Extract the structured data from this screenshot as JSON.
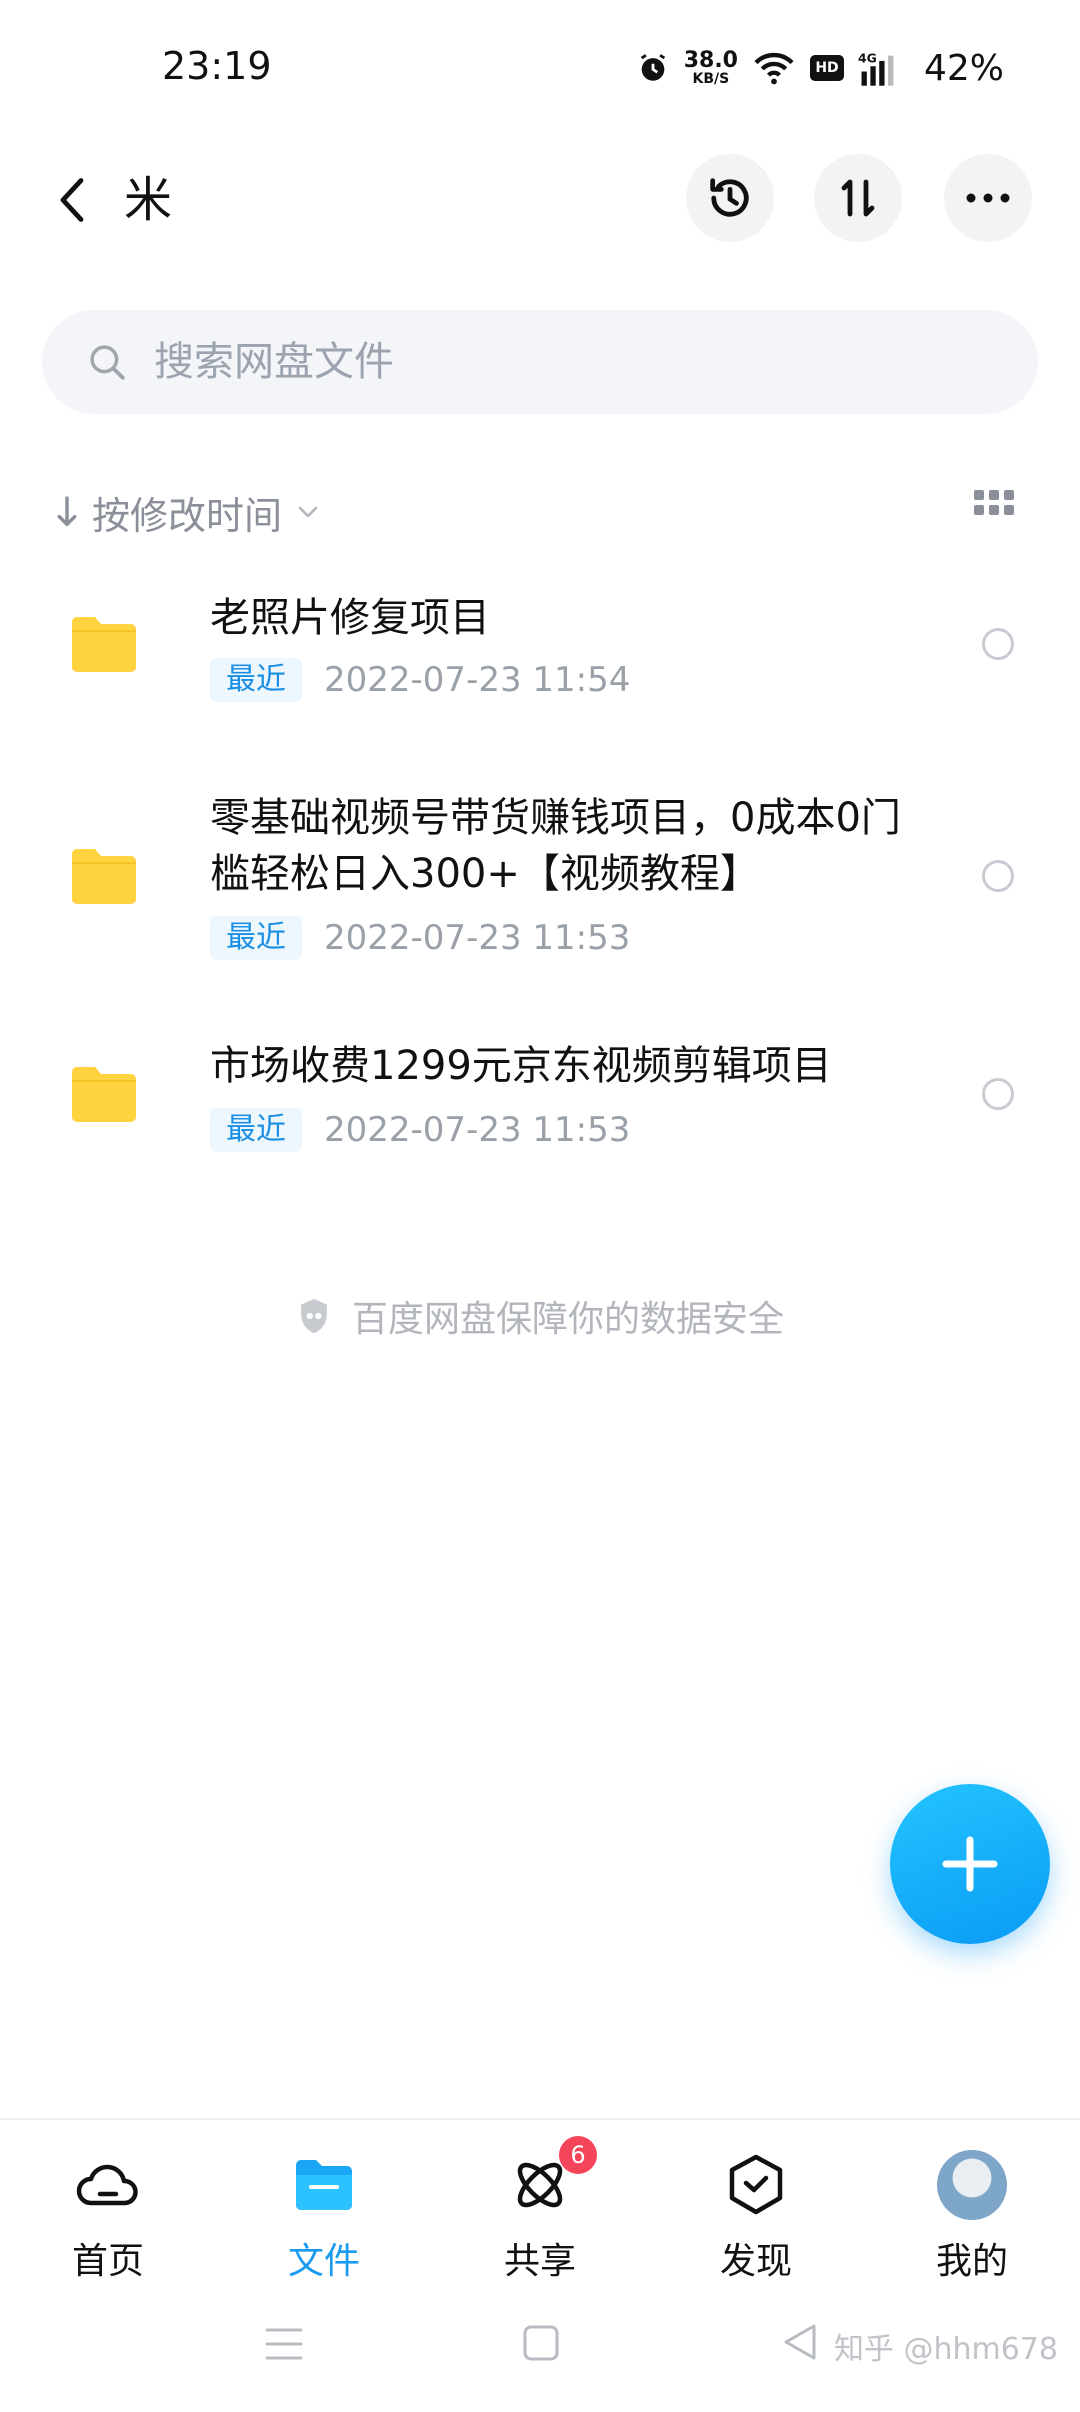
{
  "status_bar": {
    "time": "23:19",
    "net_speed_value": "38.0",
    "net_speed_unit": "KB/S",
    "battery": "42%",
    "hd_label": "HD"
  },
  "header": {
    "title": "米",
    "actions": [
      "history-icon",
      "sort-icon",
      "more-icon"
    ]
  },
  "search": {
    "placeholder": "搜索网盘文件"
  },
  "sort": {
    "label": "按修改时间"
  },
  "files": [
    {
      "name": "老照片修复项目",
      "badge": "最近",
      "date": "2022-07-23  11:54"
    },
    {
      "name": "零基础视频号带货赚钱项目，0成本0门槛轻松日入300+【视频教程】",
      "badge": "最近",
      "date": "2022-07-23  11:53"
    },
    {
      "name": "市场收费1299元京东视频剪辑项目",
      "badge": "最近",
      "date": "2022-07-23  11:53"
    }
  ],
  "footer_note": "百度网盘保障你的数据安全",
  "tabs": [
    {
      "label": "首页",
      "icon": "cloud-icon"
    },
    {
      "label": "文件",
      "icon": "folder-icon",
      "active": true
    },
    {
      "label": "共享",
      "icon": "atom-icon",
      "badge": "6"
    },
    {
      "label": "发现",
      "icon": "discover-icon"
    },
    {
      "label": "我的",
      "icon": "avatar"
    }
  ],
  "watermark": "知乎 @hhm678",
  "colors": {
    "accent": "#1a9bf0",
    "folder": "#ffd33f",
    "badge_red": "#f5455a"
  }
}
